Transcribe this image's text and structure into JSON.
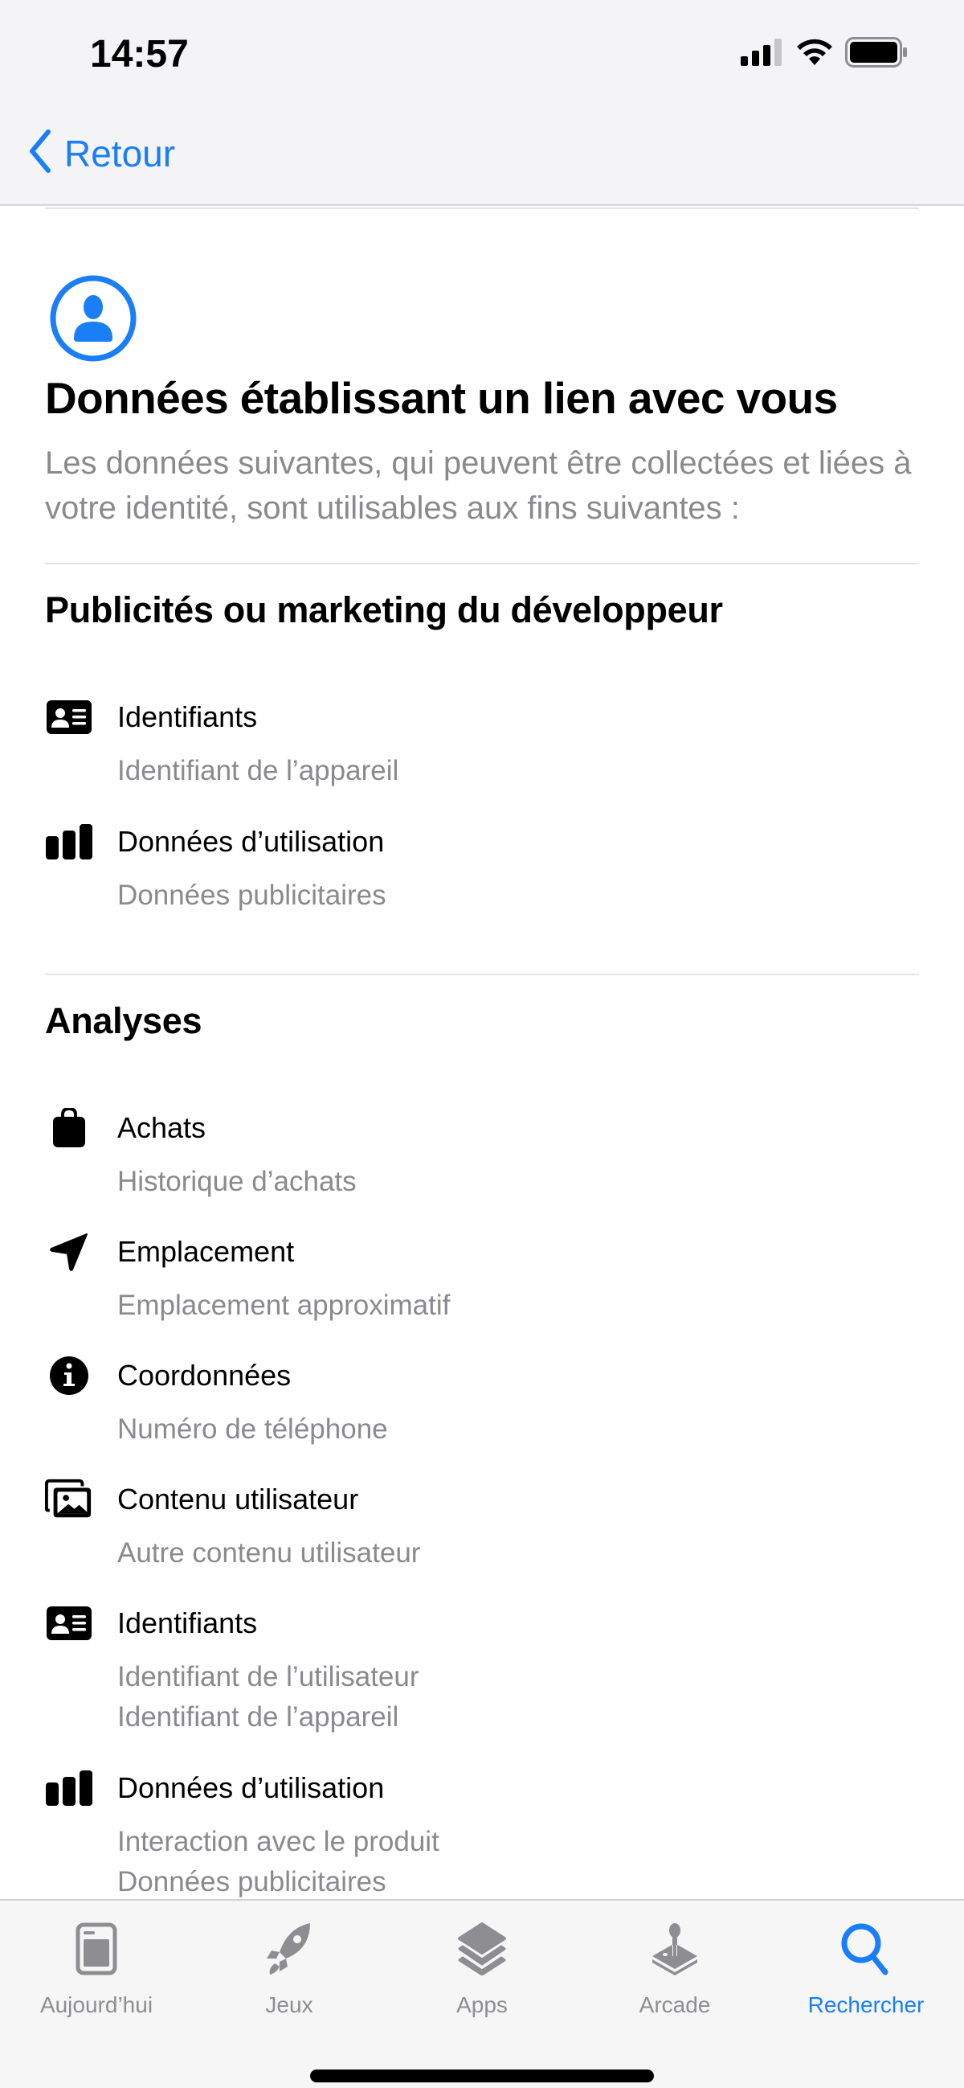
{
  "status_bar": {
    "time": "14:57",
    "icons": [
      "cellular-signal-icon",
      "wifi-icon",
      "battery-icon"
    ]
  },
  "nav": {
    "back_label": "Retour",
    "back_icon": "chevron-left-icon"
  },
  "header": {
    "icon": "person-circle-icon",
    "title": "Données établissant un lien avec vous",
    "description": "Les données suivantes, qui peuvent être collectées et liées à votre identité, sont utilisables aux fins suivantes :"
  },
  "sections": [
    {
      "title": "Publicités ou marketing du développeur",
      "items": [
        {
          "icon": "id-card-icon",
          "label": "Identifiants",
          "details": [
            "Identifiant de l’appareil"
          ]
        },
        {
          "icon": "bar-chart-icon",
          "label": "Données d’utilisation",
          "details": [
            "Données publicitaires"
          ]
        }
      ]
    },
    {
      "title": "Analyses",
      "items": [
        {
          "icon": "shopping-bag-icon",
          "label": "Achats",
          "details": [
            "Historique d’achats"
          ]
        },
        {
          "icon": "location-arrow-icon",
          "label": "Emplacement",
          "details": [
            "Emplacement approximatif"
          ]
        },
        {
          "icon": "info-circle-icon",
          "label": "Coordonnées",
          "details": [
            "Numéro de téléphone"
          ]
        },
        {
          "icon": "photo-stack-icon",
          "label": "Contenu utilisateur",
          "details": [
            "Autre contenu utilisateur"
          ]
        },
        {
          "icon": "id-card-icon",
          "label": "Identifiants",
          "details": [
            "Identifiant de l’utilisateur",
            "Identifiant de l’appareil"
          ]
        },
        {
          "icon": "bar-chart-icon",
          "label": "Données d’utilisation",
          "details": [
            "Interaction avec le produit",
            "Données publicitaires"
          ]
        }
      ]
    }
  ],
  "tabbar": {
    "active_color": "#1a7ef7",
    "inactive_color": "#8e8e92",
    "tabs": [
      {
        "icon": "today-icon",
        "label": "Aujourd’hui",
        "active": false
      },
      {
        "icon": "rocket-icon",
        "label": "Jeux",
        "active": false
      },
      {
        "icon": "apps-stack-icon",
        "label": "Apps",
        "active": false
      },
      {
        "icon": "joystick-icon",
        "label": "Arcade",
        "active": false
      },
      {
        "icon": "search-icon",
        "label": "Rechercher",
        "active": true
      }
    ]
  }
}
